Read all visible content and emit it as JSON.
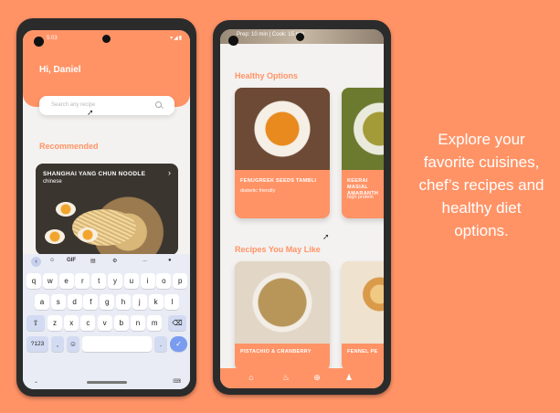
{
  "left_screen": {
    "status_time": "5:03",
    "greeting": "Hi, Daniel",
    "search": {
      "placeholder": "Search any recipe"
    },
    "recommended_title": "Recommended",
    "recommended_card": {
      "title": "SHANGHAI YANG CHUN NOODLE",
      "subtitle": "chinese"
    },
    "keyboard": {
      "toolbar": [
        "GIF",
        "..."
      ],
      "row1": [
        "q",
        "w",
        "e",
        "r",
        "t",
        "y",
        "u",
        "i",
        "o",
        "p"
      ],
      "row2": [
        "a",
        "s",
        "d",
        "f",
        "g",
        "h",
        "j",
        "k",
        "l"
      ],
      "row3": [
        "z",
        "x",
        "c",
        "v",
        "b",
        "n",
        "m"
      ],
      "row4": {
        "numbers": "?123",
        "comma": ",",
        "period": "."
      }
    }
  },
  "right_screen": {
    "top_strip_text": "Prep: 10 min | Cook: 15 min",
    "healthy_title": "Healthy Options",
    "healthy_cards": [
      {
        "name": "FENUGREEK SEEDS TAMBLI",
        "tag": "diabetic friendly"
      },
      {
        "name": "KEERAI MASIAL AMARANTH",
        "tag": "high protein"
      }
    ],
    "recipes_title": "Recipes You May Like",
    "recipe_cards": [
      {
        "name": "PISTACHIO & CRANBERRY"
      },
      {
        "name": "FENNEL PE"
      }
    ],
    "bottom_nav_icons": [
      "home-icon",
      "chef-hat-icon",
      "add-icon",
      "profile-icon"
    ]
  },
  "caption": "Explore your favorite cuisines, chef’s recipes and healthy diet options.",
  "colors": {
    "accent": "#FF9366",
    "background": "#FF9366"
  }
}
